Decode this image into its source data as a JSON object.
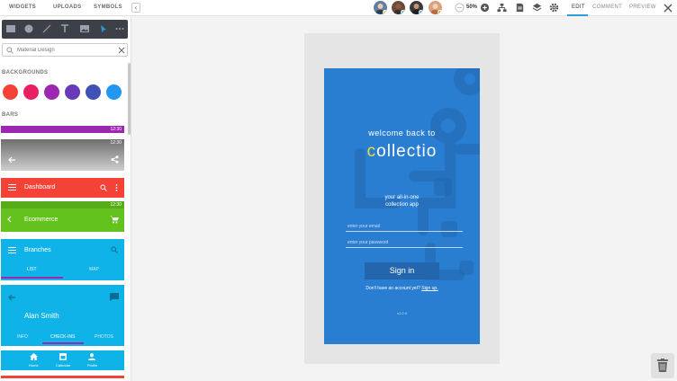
{
  "topbar": {
    "tabs": [
      "WIDGETS",
      "UPLOADS",
      "SYMBOLS"
    ],
    "collapse_glyph": "‹",
    "zoom": "50%",
    "right_tabs": [
      "EDIT",
      "COMMENT",
      "PREVIEW"
    ],
    "presence_colors": [
      "#f7c948",
      "#5ac8a0",
      "#3fb3e8",
      "#f0a54a"
    ]
  },
  "sidebar": {
    "search_placeholder": "Material Design",
    "backgrounds_label": "BACKGROUNDS",
    "bars_label": "BARS",
    "swatches": [
      "#f44336",
      "#e91e63",
      "#9c27b0",
      "#673ab7",
      "#3f51b5",
      "#2196f3"
    ],
    "status_time": "12:30",
    "dashboard_title": "Dashboard",
    "ecommerce_title": "Ecommerce",
    "branches_title": "Branches",
    "branches_tabs": [
      "LIST",
      "MAP"
    ],
    "profile_name": "Alan Smith",
    "profile_tabs": [
      "INFO",
      "CHECK-INS",
      "PHOTOS"
    ],
    "bottom_nav": [
      "Home",
      "Calendar",
      "Profile"
    ]
  },
  "phone": {
    "welcome": "welcome back to",
    "brand_first": "c",
    "brand_rest": "ollectio",
    "tagline_1": "your all-in-one",
    "tagline_2": "collection app",
    "email_placeholder": "enter your email",
    "password_placeholder": "enter your password",
    "signin_label": "Sign in",
    "no_account": "Don't have an account yet?",
    "signup_link": "Sign up.",
    "version": "v1.0.0"
  }
}
